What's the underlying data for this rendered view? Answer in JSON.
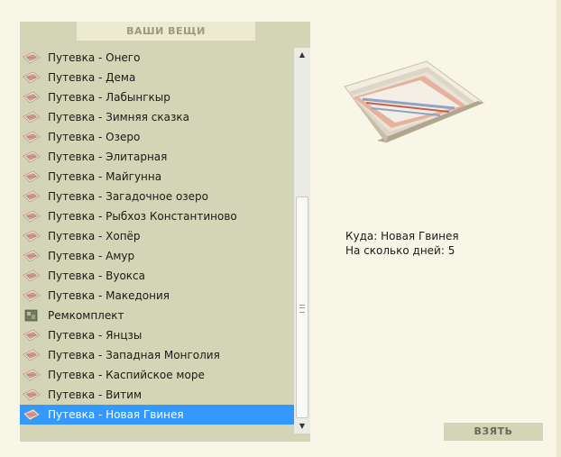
{
  "panel": {
    "title": "ВАШИ ВЕЩИ"
  },
  "items": [
    {
      "label": "Путевка - Онего",
      "icon": "ticket-icon",
      "selected": false
    },
    {
      "label": "Путевка - Дема",
      "icon": "ticket-icon",
      "selected": false
    },
    {
      "label": "Путевка - Лабынгкыр",
      "icon": "ticket-icon",
      "selected": false
    },
    {
      "label": "Путевка - Зимняя сказка",
      "icon": "ticket-icon",
      "selected": false
    },
    {
      "label": "Путевка - Озеро",
      "icon": "ticket-icon",
      "selected": false
    },
    {
      "label": "Путевка - Элитарная",
      "icon": "ticket-icon",
      "selected": false
    },
    {
      "label": "Путевка - Майгунна",
      "icon": "ticket-icon",
      "selected": false
    },
    {
      "label": "Путевка - Загадочное озеро",
      "icon": "ticket-icon",
      "selected": false
    },
    {
      "label": "Путевка - Рыбхоз Константиново",
      "icon": "ticket-icon",
      "selected": false
    },
    {
      "label": "Путевка - Хопёр",
      "icon": "ticket-icon",
      "selected": false
    },
    {
      "label": "Путевка - Амур",
      "icon": "ticket-icon",
      "selected": false
    },
    {
      "label": "Путевка - Вуокса",
      "icon": "ticket-icon",
      "selected": false
    },
    {
      "label": "Путевка - Македония",
      "icon": "ticket-icon",
      "selected": false
    },
    {
      "label": "Ремкомплект",
      "icon": "repair-kit-icon",
      "selected": false
    },
    {
      "label": "Путевка - Янцзы",
      "icon": "ticket-icon",
      "selected": false
    },
    {
      "label": "Путевка - Западная Монголия",
      "icon": "ticket-icon",
      "selected": false
    },
    {
      "label": "Путевка - Каспийское море",
      "icon": "ticket-icon",
      "selected": false
    },
    {
      "label": "Путевка - Витим",
      "icon": "ticket-icon",
      "selected": false
    },
    {
      "label": "Путевка - Новая Гвинея",
      "icon": "ticket-icon",
      "selected": true
    }
  ],
  "details": {
    "destination": "Куда: Новая Гвинея",
    "days": "На сколько дней: 5"
  },
  "actions": {
    "take_label": "ВЗЯТЬ"
  },
  "colors": {
    "background": "#f8f7e7",
    "panel": "#d4d4b6",
    "selection": "#3399ff"
  }
}
